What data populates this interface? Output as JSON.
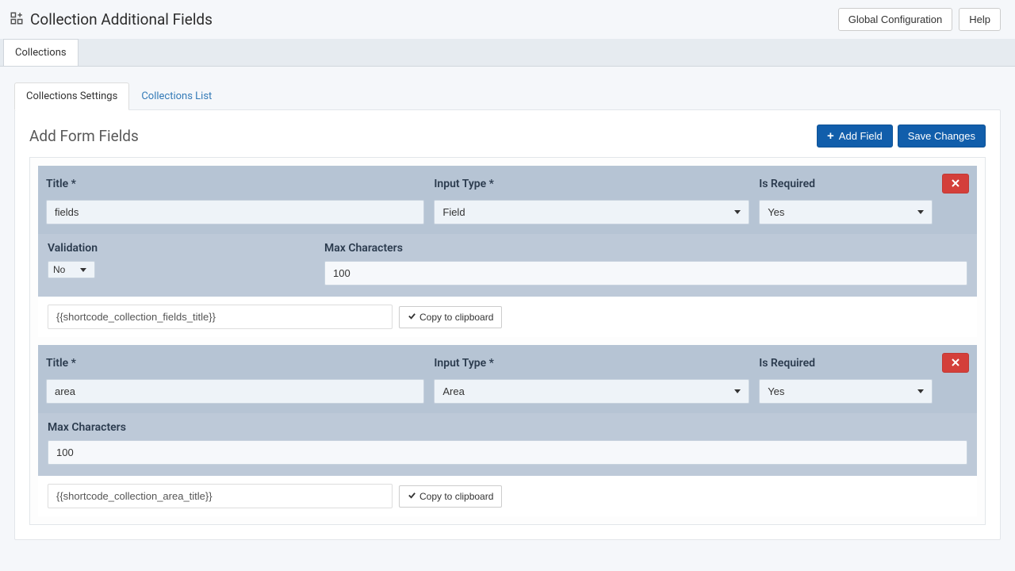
{
  "header": {
    "title": "Collection Additional Fields",
    "actions": {
      "global_config": "Global Configuration",
      "help": "Help"
    }
  },
  "primary_tabs": {
    "collections": "Collections"
  },
  "secondary_tabs": {
    "settings": "Collections Settings",
    "list": "Collections List"
  },
  "panel": {
    "title": "Add Form Fields",
    "actions": {
      "add_field": "Add Field",
      "save_changes": "Save Changes"
    }
  },
  "labels": {
    "title": "Title *",
    "input_type": "Input Type *",
    "is_required": "Is Required",
    "validation": "Validation",
    "max_chars": "Max Characters"
  },
  "copy_label": "Copy to clipboard",
  "fields": [
    {
      "title_value": "fields",
      "input_type_value": "Field",
      "is_required_value": "Yes",
      "validation_value": "No",
      "max_chars_value": "100",
      "shortcode": "{{shortcode_collection_fields_title}}",
      "has_validation": true
    },
    {
      "title_value": "area",
      "input_type_value": "Area",
      "is_required_value": "Yes",
      "max_chars_value": "100",
      "shortcode": "{{shortcode_collection_area_title}}",
      "has_validation": false
    }
  ]
}
